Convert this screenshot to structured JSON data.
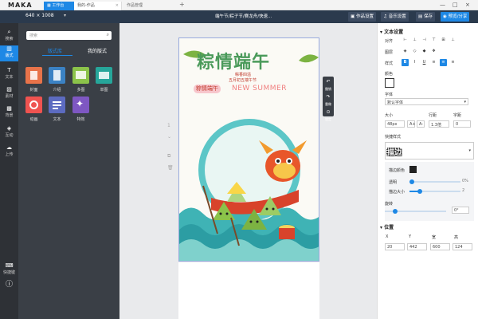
{
  "app": {
    "logo": "MAKA"
  },
  "tabs": [
    {
      "label": "工作台"
    },
    {
      "label": "我的-作品"
    },
    {
      "label": "作品管理"
    }
  ],
  "toolbar": {
    "size": "640 × 1008",
    "title": "端午节/粽子节/赛龙舟/快速...",
    "work_settings": "作品设置",
    "music_settings": "音乐设置",
    "save": "保存",
    "preview_share": "预览/分享"
  },
  "nav": [
    {
      "label": "搜索"
    },
    {
      "label": "版式"
    },
    {
      "label": "文本"
    },
    {
      "label": "素材"
    },
    {
      "label": "背景"
    },
    {
      "label": "互动"
    },
    {
      "label": "上传"
    },
    {
      "label": "快捷键"
    }
  ],
  "panel": {
    "search_placeholder": "搜索",
    "tab_library": "版式库",
    "tab_mine": "我的版式",
    "tiles": [
      {
        "label": "封面",
        "color": "#e8734a"
      },
      {
        "label": "介绍",
        "color": "#3b82c4"
      },
      {
        "label": "多图",
        "color": "#8bc34a"
      },
      {
        "label": "单图",
        "color": "#26a69a"
      },
      {
        "label": "动画",
        "color": "#ef5350"
      },
      {
        "label": "文本",
        "color": "#5c6bc0"
      },
      {
        "label": "特效",
        "color": "#7e57c2"
      }
    ]
  },
  "poster": {
    "title": "粽情端午",
    "sub1": "粽香四溢",
    "sub2": "五月初五端午节",
    "badge": "粽情端午",
    "english": "NEW SUMMER"
  },
  "floatbar": {
    "undo": "撤销",
    "redo": "重做",
    "lock": "锁定"
  },
  "props": {
    "text_settings": "文本设置",
    "align": "对齐",
    "layer": "图层",
    "style": "样式",
    "color": "颜色",
    "font": "字体",
    "font_value": "默认字体",
    "size_label": "大小",
    "size_value": "48px",
    "line_height_label": "行距",
    "line_height_value": "1.3倍",
    "spacing_label": "字距",
    "spacing_value": "0",
    "quick_style": "快捷样式",
    "quick_sample": "描边",
    "stroke_color": "描边颜色",
    "opacity": "透明",
    "opacity_value": "0%",
    "stroke_size": "描边大小",
    "stroke_size_value": "2",
    "rotate": "旋转",
    "rotate_value": "0°",
    "position": "位置",
    "pos_headers": [
      "X",
      "Y",
      "宽",
      "高"
    ],
    "pos_values": [
      "20",
      "442",
      "600",
      "124"
    ]
  }
}
